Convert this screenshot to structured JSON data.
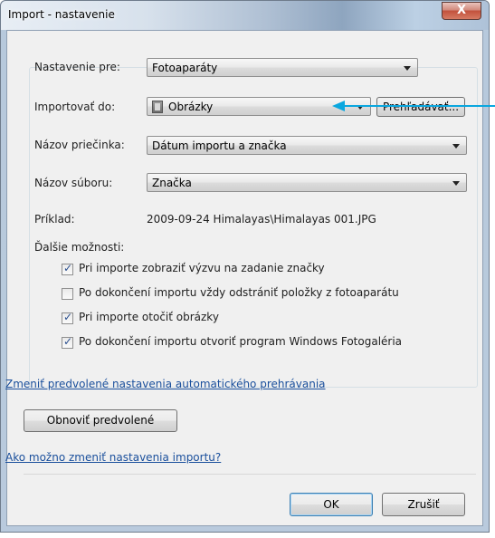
{
  "window": {
    "title": "Import - nastavenie",
    "close_label": "X"
  },
  "settings_for": {
    "label": "Nastavenie pre:",
    "value": "Fotoaparáty"
  },
  "import_to": {
    "label": "Importovať do:",
    "value": "Obrázky",
    "browse_label": "Prehľadávať..."
  },
  "folder_name": {
    "label": "Názov priečinka:",
    "value": "Dátum importu a značka"
  },
  "file_name": {
    "label": "Názov súboru:",
    "value": "Značka"
  },
  "example": {
    "label": "Príklad:",
    "value": "2009-09-24 Himalayas\\Himalayas 001.JPG"
  },
  "more_options": {
    "label": "Ďalšie možnosti:",
    "items": [
      {
        "label": "Pri importe zobraziť výzvu na zadanie značky",
        "checked": true
      },
      {
        "label": "Po dokončení importu vždy odstrániť položky z fotoaparátu",
        "checked": false
      },
      {
        "label": "Pri importe otočiť obrázky",
        "checked": true
      },
      {
        "label": "Po dokončení importu otvoriť program Windows Fotogaléria",
        "checked": true
      }
    ]
  },
  "links": {
    "change_autoplay": "Zmeniť predvolené nastavenia automatického prehrávania",
    "how_to_change": "Ako možno zmeniť nastavenia importu?"
  },
  "buttons": {
    "restore_defaults": "Obnoviť predvolené",
    "ok": "OK",
    "cancel": "Zrušiť"
  },
  "colors": {
    "accent_callout": "#0aa7df",
    "link": "#1a4f9c"
  }
}
